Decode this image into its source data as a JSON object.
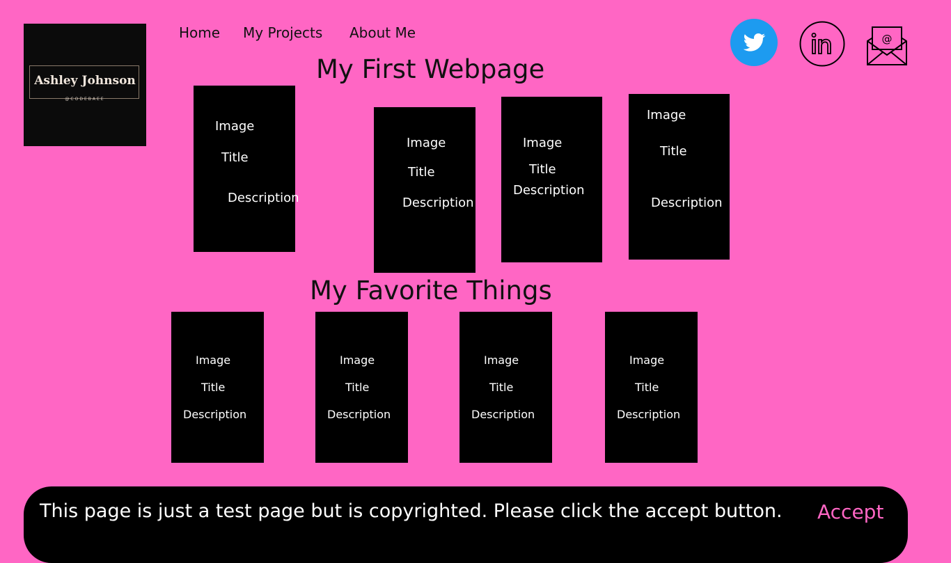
{
  "logo": {
    "name": "Ashley Johnson",
    "handle": "@CODEBAEE"
  },
  "nav": {
    "home": "Home",
    "projects": "My Projects",
    "about": "About Me"
  },
  "social": {
    "twitter_icon": "twitter-icon",
    "linkedin_icon": "linkedin-icon",
    "email_icon": "email-icon",
    "twitter_color": "#1d9bf0"
  },
  "section1": {
    "heading": "My First Webpage",
    "cards": [
      {
        "image": "Image",
        "title": "Title",
        "description": "Description"
      },
      {
        "image": "Image",
        "title": "Title",
        "description": "Description"
      },
      {
        "image": "Image",
        "title": "Title",
        "description": "Description"
      },
      {
        "image": "Image",
        "title": "Title",
        "description": "Description"
      }
    ]
  },
  "section2": {
    "heading": "My Favorite Things",
    "cards": [
      {
        "image": "Image",
        "title": "Title",
        "description": "Description"
      },
      {
        "image": "Image",
        "title": "Title",
        "description": "Description"
      },
      {
        "image": "Image",
        "title": "Title",
        "description": "Description"
      },
      {
        "image": "Image",
        "title": "Title",
        "description": "Description"
      }
    ]
  },
  "banner": {
    "text": "This page is just a test page but is copyrighted. Please click the accept button.",
    "accept": "Accept"
  },
  "colors": {
    "background": "#ff66c4",
    "card": "#000000",
    "accent": "#ff66c4"
  }
}
